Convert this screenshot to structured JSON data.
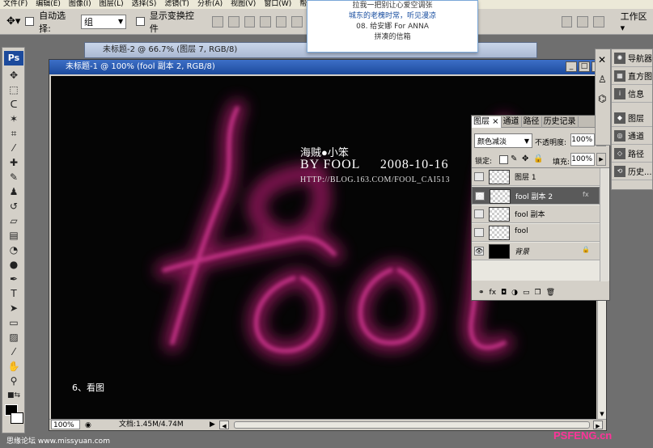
{
  "menubar": {
    "items": [
      "文件(F)",
      "编辑(E)",
      "图像(I)",
      "图层(L)",
      "选择(S)",
      "滤镜(T)",
      "分析(A)",
      "视图(V)",
      "窗口(W)",
      "帮"
    ]
  },
  "options": {
    "auto_select_label": "自动选择:",
    "auto_select_value": "组",
    "show_transform_label": "显示变换控件",
    "workspace_label": "工作区 ▾"
  },
  "popup": {
    "line1": "拉我一把别让心爱空调张",
    "line2": "城东的老槐时常，听见漫凉",
    "line3": "08. 给安娜 For ANNA",
    "line4": "拼凑的信箱"
  },
  "toolbox": {
    "logo": "Ps"
  },
  "doc2": {
    "title": "未标题-2 @ 66.7% (图层 7, RGB/8)"
  },
  "doc1": {
    "title": "未标题-1 @ 100% (fool 副本 2, RGB/8)",
    "zoom": "100%",
    "doc_info": "文档:1.45M/4.74M",
    "caption": "6、看图"
  },
  "artwork": {
    "author": "海贼●小笨",
    "byline": "BY FOOL",
    "date": "2008-10-16",
    "url": "HTTP://BLOG.163.COM/FOOL_CAI513",
    "glow_text": "fool",
    "glow_color": "#c0207a"
  },
  "layers_panel": {
    "tabs": [
      "图层",
      "通道",
      "路径",
      "历史记录"
    ],
    "blend_mode": "颜色减淡",
    "opacity_label": "不透明度:",
    "opacity_value": "100%",
    "lock_label": "锁定:",
    "fill_label": "填充:",
    "fill_value": "100%",
    "layers": [
      {
        "name": "图层 1",
        "visible": false,
        "selected": false
      },
      {
        "name": "fool 副本 2",
        "visible": true,
        "selected": true
      },
      {
        "name": "fool 副本",
        "visible": false,
        "selected": false
      },
      {
        "name": "fool",
        "visible": false,
        "selected": false
      },
      {
        "name": "背景",
        "visible": true,
        "selected": false
      }
    ]
  },
  "dock": {
    "items": [
      "导航器",
      "直方图",
      "信息",
      "图层",
      "通道",
      "路径",
      "历史..."
    ]
  },
  "watermarks": {
    "left": "思缘论坛 www.missyuan.com",
    "right": "PSFENG.cn"
  }
}
